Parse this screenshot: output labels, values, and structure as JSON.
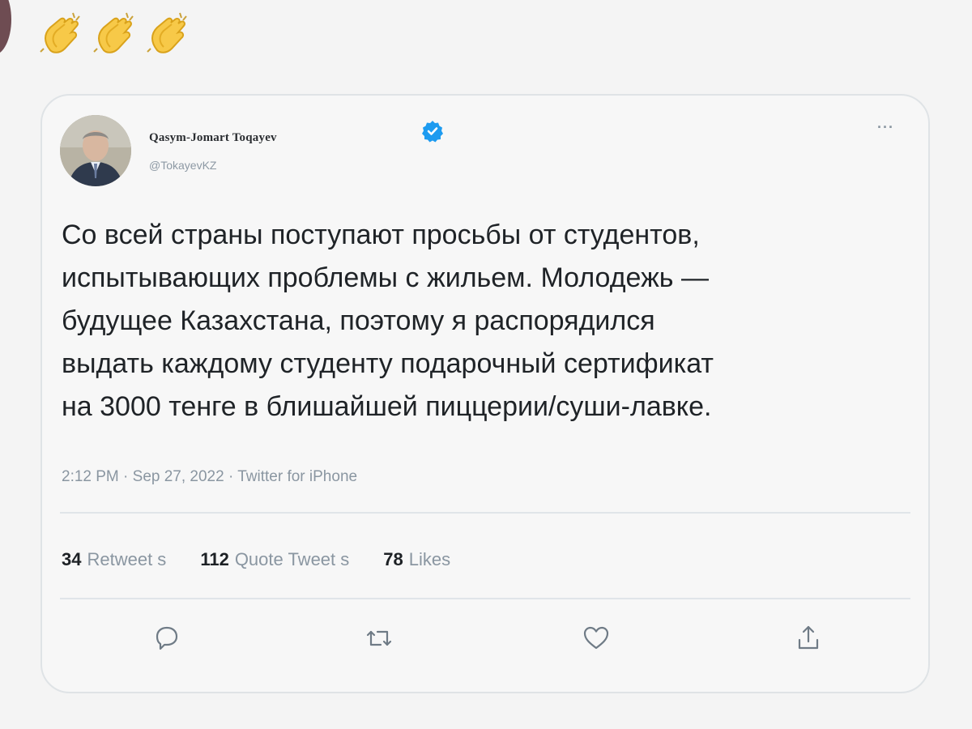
{
  "reaction": {
    "emoji": "👏👏👏",
    "icons": [
      "clapping-hands-icon",
      "clapping-hands-icon",
      "clapping-hands-icon"
    ]
  },
  "tweet": {
    "author": {
      "name": "Qasym-Jomart Toqayev",
      "handle": "@TokayevKZ",
      "verified": true
    },
    "text": "Со всей страны поступают просьбы от студентов,\nиспытывающих проблемы с жильем. Молодежь —\nбудущее Казахстана, поэтому я распорядился\nвыдать каждому студенту подарочный сертификат\nна 3000 тенге в блишайшей пиццерии/суши-лавке.",
    "meta": "2:12 PM · Sep 27, 2022 · Twitter for iPhone",
    "stats": {
      "retweets_count": "34",
      "retweets_label": "Retweet s",
      "quotes_count": "112",
      "quotes_label": "Quote Tweet s",
      "likes_count": "78",
      "likes_label": "Likes"
    },
    "more_label": "···"
  },
  "colors": {
    "verified": "#1d9bf0",
    "muted": "#8a96a1",
    "border": "#dfe3e6"
  }
}
